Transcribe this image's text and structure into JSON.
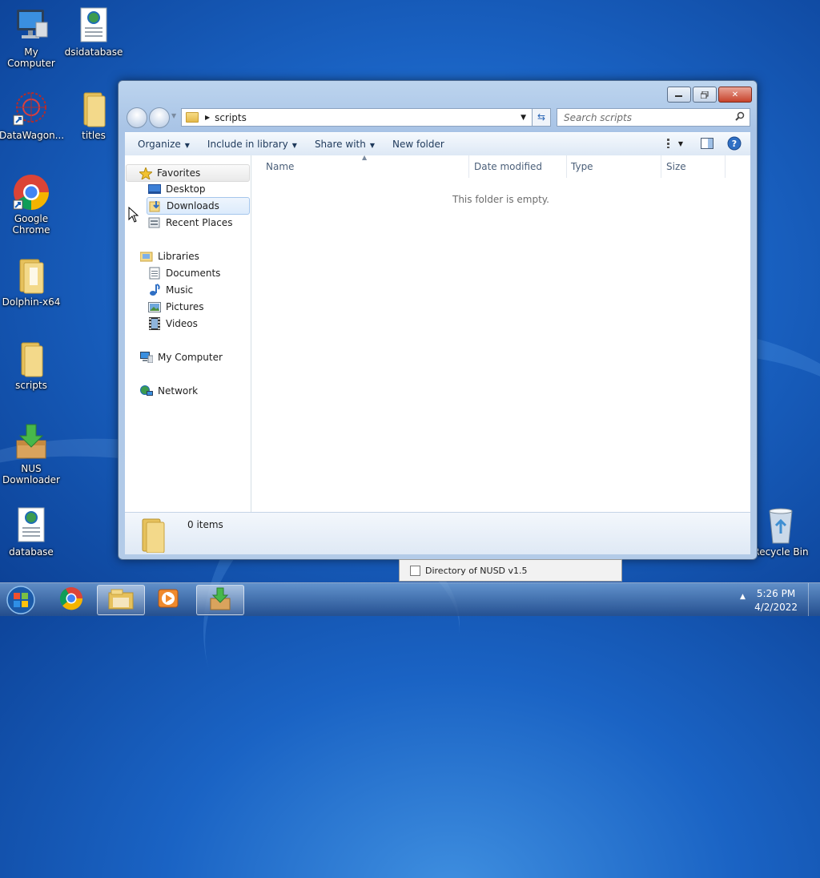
{
  "desktop": {
    "icons": [
      {
        "label": "My Computer",
        "icon": "my-computer-icon"
      },
      {
        "label": "dsidatabase",
        "icon": "web-document-icon"
      },
      {
        "label": "DataWagon...",
        "icon": "datawagon-shortcut-icon"
      },
      {
        "label": "titles",
        "icon": "folder-icon"
      },
      {
        "label": "Google Chrome",
        "icon": "chrome-icon"
      },
      {
        "label": "Dolphin-x64",
        "icon": "folder-icon"
      },
      {
        "label": "scripts",
        "icon": "folder-icon"
      },
      {
        "label": "NUS Downloader",
        "icon": "download-box-icon"
      },
      {
        "label": "database",
        "icon": "web-document-icon"
      },
      {
        "label": "Recycle Bin",
        "icon": "recycle-bin-icon"
      }
    ]
  },
  "explorer": {
    "address": {
      "path": "scripts"
    },
    "search": {
      "placeholder": "Search scripts"
    },
    "toolbar": {
      "organize": "Organize",
      "include_in_library": "Include in library",
      "share_with": "Share with",
      "new_folder": "New folder"
    },
    "nav": {
      "favorites": "Favorites",
      "desktop": "Desktop",
      "downloads": "Downloads",
      "recent_places": "Recent Places",
      "libraries": "Libraries",
      "documents": "Documents",
      "music": "Music",
      "pictures": "Pictures",
      "videos": "Videos",
      "my_computer": "My Computer",
      "network": "Network"
    },
    "columns": {
      "name": "Name",
      "date_modified": "Date modified",
      "type": "Type",
      "size": "Size"
    },
    "empty_message": "This folder is empty.",
    "details": {
      "count": "0 items"
    }
  },
  "tooltip": {
    "label": "Directory of NUSD v1.5"
  },
  "taskbar": {
    "time": "5:26 PM",
    "date": "4/2/2022"
  }
}
